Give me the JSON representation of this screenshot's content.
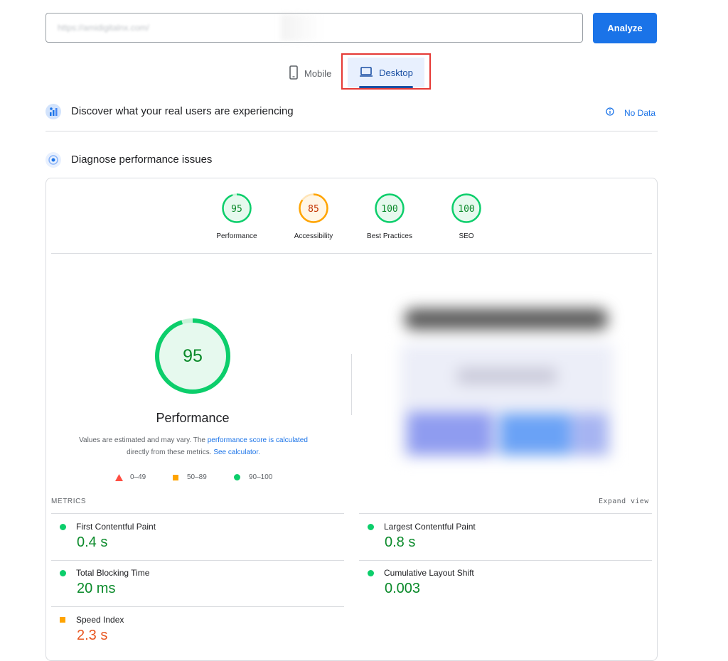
{
  "search": {
    "url_value": "https://amidigitalnx.com/",
    "analyze_label": "Analyze"
  },
  "tabs": {
    "mobile": "Mobile",
    "desktop": "Desktop"
  },
  "real_users": {
    "title": "Discover what your real users are experiencing",
    "status": "No Data"
  },
  "diagnose": {
    "title": "Diagnose performance issues"
  },
  "scores": [
    {
      "label": "Performance",
      "value": "95",
      "status": "pass"
    },
    {
      "label": "Accessibility",
      "value": "85",
      "status": "average"
    },
    {
      "label": "Best Practices",
      "value": "100",
      "status": "pass"
    },
    {
      "label": "SEO",
      "value": "100",
      "status": "pass"
    }
  ],
  "performance": {
    "score": "95",
    "label": "Performance",
    "note_pre": "Values are estimated and may vary. The ",
    "note_link": "performance score is calculated",
    "note_mid": "directly from these metrics. ",
    "note_link2": "See calculator."
  },
  "legend": {
    "fail": "0–49",
    "average": "50–89",
    "pass": "90–100"
  },
  "metrics_header": {
    "title": "METRICS",
    "expand": "Expand view"
  },
  "metrics": [
    {
      "name": "First Contentful Paint",
      "value": "0.4 s",
      "status": "pass"
    },
    {
      "name": "Largest Contentful Paint",
      "value": "0.8 s",
      "status": "pass"
    },
    {
      "name": "Total Blocking Time",
      "value": "20 ms",
      "status": "pass"
    },
    {
      "name": "Cumulative Layout Shift",
      "value": "0.003",
      "status": "pass"
    },
    {
      "name": "Speed Index",
      "value": "2.3 s",
      "status": "average"
    }
  ],
  "colors": {
    "pass": "#0cce6b",
    "average": "#ffa400",
    "fail": "#ff4e42",
    "brand": "#1a73e8"
  },
  "icons": {
    "mobile": "smartphone-icon",
    "desktop": "laptop-icon",
    "info": "info-icon"
  }
}
